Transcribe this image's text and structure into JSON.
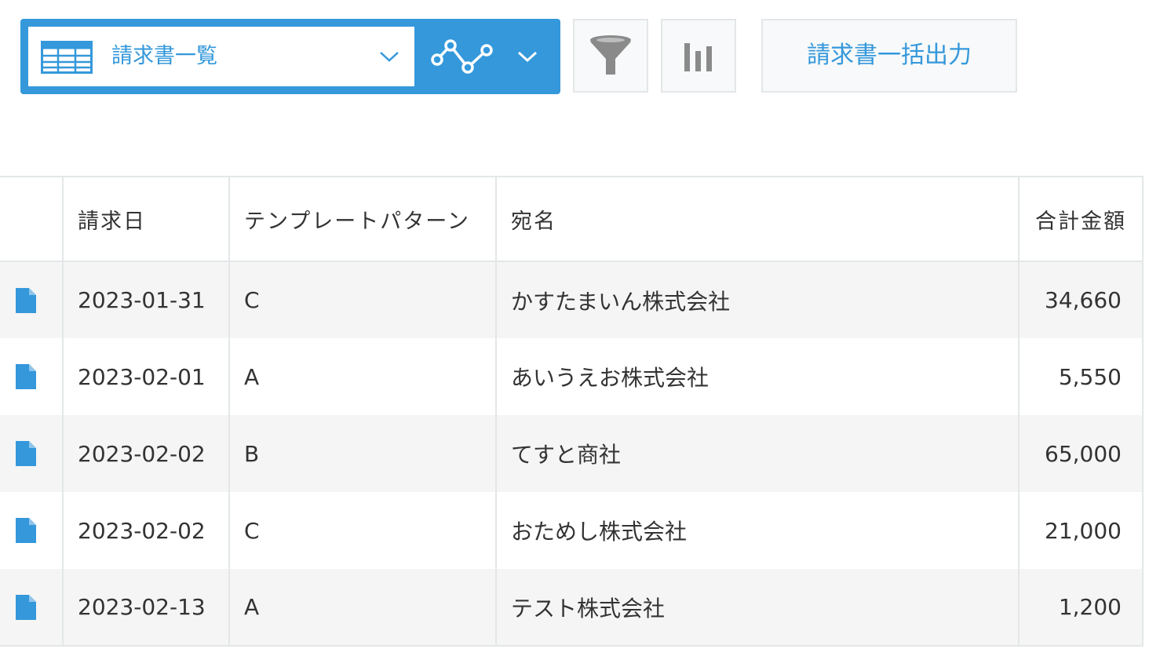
{
  "toolbar": {
    "view_name": "請求書一覧",
    "view_icon": "table-icon",
    "graph_icon": "graph-icon",
    "filter_icon": "filter-icon",
    "chart_icon": "bar-chart-icon",
    "export_label": "請求書一括出力",
    "accent_color": "#3498db"
  },
  "table": {
    "headers": {
      "date": "請求日",
      "template": "テンプレートパターン",
      "recipient": "宛名",
      "total": "合計金額"
    },
    "rows": [
      {
        "date": "2023-01-31",
        "template": "C",
        "recipient": "かすたまいん株式会社",
        "total": "34,660"
      },
      {
        "date": "2023-02-01",
        "template": "A",
        "recipient": "あいうえお株式会社",
        "total": "5,550"
      },
      {
        "date": "2023-02-02",
        "template": "B",
        "recipient": "てすと商社",
        "total": "65,000"
      },
      {
        "date": "2023-02-02",
        "template": "C",
        "recipient": "おためし株式会社",
        "total": "21,000"
      },
      {
        "date": "2023-02-13",
        "template": "A",
        "recipient": "テスト株式会社",
        "total": "1,200"
      }
    ]
  }
}
